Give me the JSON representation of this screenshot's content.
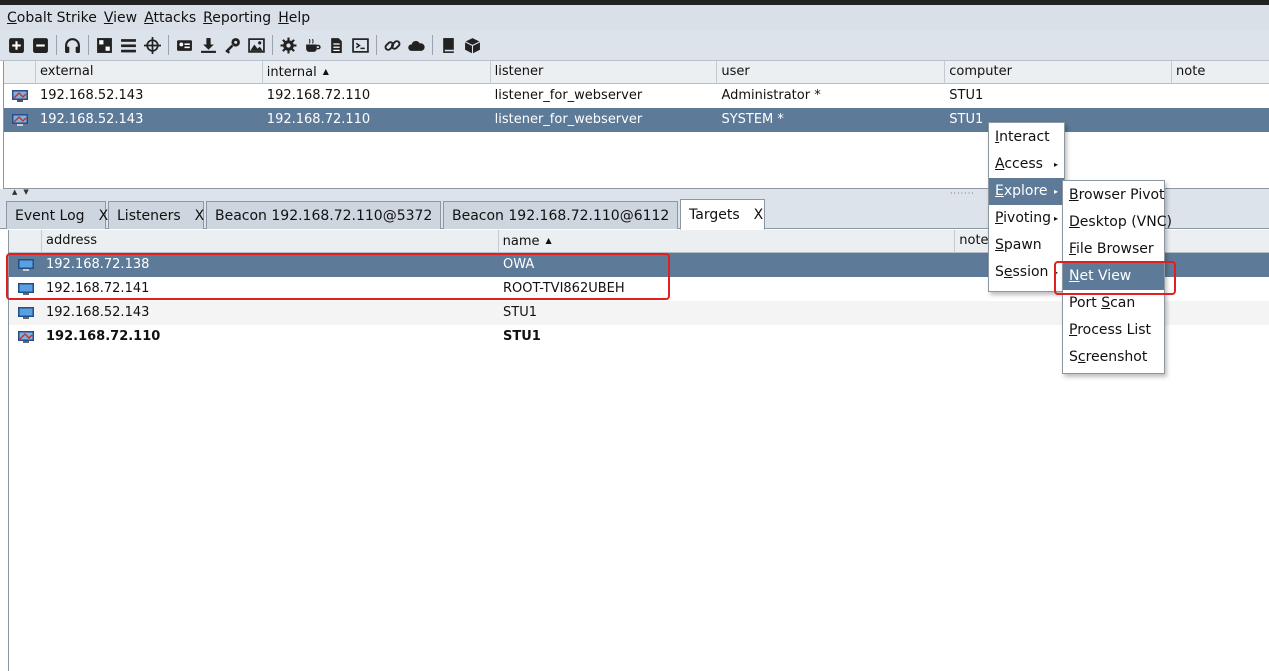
{
  "menubar": [
    {
      "label": "Cobalt Strike",
      "key": "C",
      "rest": "obalt Strike"
    },
    {
      "label": "View",
      "key": "V",
      "rest": "iew"
    },
    {
      "label": "Attacks",
      "key": "A",
      "rest": "ttacks"
    },
    {
      "label": "Reporting",
      "key": "R",
      "rest": "eporting"
    },
    {
      "label": "Help",
      "key": "H",
      "rest": "elp"
    }
  ],
  "toolbar_icons": [
    "plus-icon",
    "minus-icon",
    "headphones-icon",
    "pivot-graph-icon",
    "session-list-icon",
    "target-icon",
    "credential-icon",
    "download-icon",
    "key-icon",
    "image-icon",
    "gear-icon",
    "coffee-icon",
    "document-icon",
    "console-icon",
    "link-icon",
    "cloud-icon",
    "book-icon",
    "package-icon"
  ],
  "beacons": {
    "columns": [
      "external",
      "internal",
      "listener",
      "user",
      "computer",
      "note"
    ],
    "sort_column": "internal",
    "rows": [
      {
        "external": "192.168.52.143",
        "internal": "192.168.72.110",
        "listener": "listener_for_webserver",
        "user": "Administrator *",
        "computer": "STU1",
        "note": ""
      },
      {
        "external": "192.168.52.143",
        "internal": "192.168.72.110",
        "listener": "listener_for_webserver",
        "user": "SYSTEM *",
        "computer": "STU1",
        "note": ""
      }
    ]
  },
  "tabs": [
    {
      "label": "Event Log",
      "close": "X"
    },
    {
      "label": "Listeners",
      "close": "X"
    },
    {
      "label": "Beacon 192.168.72.110@5372",
      "close": "X"
    },
    {
      "label": "Beacon 192.168.72.110@6112",
      "close": "X"
    },
    {
      "label": "Targets",
      "close": "X"
    }
  ],
  "targets": {
    "columns": [
      "address",
      "name",
      "note"
    ],
    "sort_column": "name",
    "rows": [
      {
        "address": "192.168.72.138",
        "name": "OWA"
      },
      {
        "address": "192.168.72.141",
        "name": "ROOT-TVI862UBEH"
      },
      {
        "address": "192.168.52.143",
        "name": "STU1"
      },
      {
        "address": "192.168.72.110",
        "name": "STU1"
      }
    ]
  },
  "context_menu": [
    {
      "key": "I",
      "rest": "nteract",
      "submenu": false
    },
    {
      "key": "A",
      "rest": "ccess",
      "submenu": true
    },
    {
      "key": "E",
      "rest": "xplore",
      "submenu": true
    },
    {
      "key": "P",
      "rest": "ivoting",
      "submenu": true
    },
    {
      "key": "S",
      "rest": "pawn",
      "submenu": false
    },
    {
      "pre": "S",
      "key": "e",
      "rest": "ssion",
      "submenu": true
    }
  ],
  "explore_menu": [
    {
      "key": "B",
      "rest": "rowser Pivot"
    },
    {
      "key": "D",
      "rest": "esktop (VNC)"
    },
    {
      "key": "F",
      "rest": "ile Browser"
    },
    {
      "key": "N",
      "rest": "et View"
    },
    {
      "pre": "Port ",
      "key": "S",
      "rest": "can"
    },
    {
      "key": "P",
      "rest": "rocess List"
    },
    {
      "pre": "S",
      "key": "c",
      "rest": "reenshot"
    }
  ],
  "colors": {
    "selection": "#5d7a98",
    "highlight_box": "#e02020"
  }
}
